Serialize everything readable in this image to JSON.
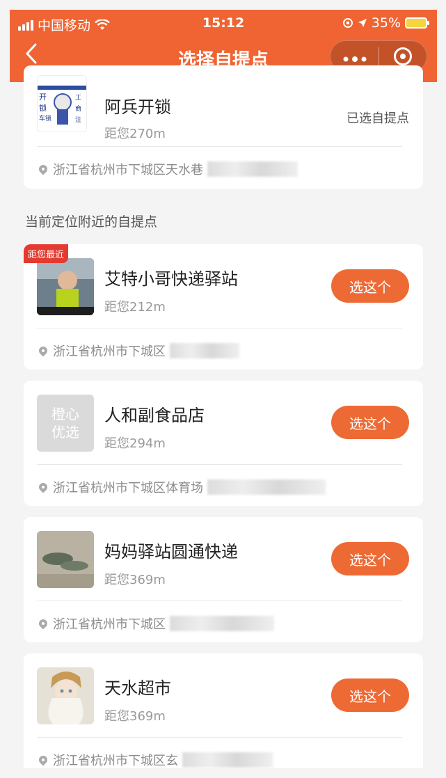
{
  "status_bar": {
    "carrier": "中国移动",
    "time": "15:12",
    "battery": "35%"
  },
  "nav": {
    "back_icon": "back-chevron-icon",
    "title": "选择自提点",
    "more_icon": "more-dots-icon",
    "close_icon": "target-circle-icon"
  },
  "selected_point": {
    "name": "阿兵开锁",
    "distance": "距您270m",
    "status": "已选自提点",
    "address": "浙江省杭州市下城区天水巷"
  },
  "section": {
    "title": "当前定位附近的自提点"
  },
  "points": [
    {
      "name": "艾特小哥快递驿站",
      "distance": "距您212m",
      "address": "浙江省杭州市下城区",
      "button": "选这个",
      "badge": "距您最近"
    },
    {
      "name": "人和副食品店",
      "distance": "距您294m",
      "address": "浙江省杭州市下城区体育场",
      "button": "选这个",
      "logo_text": "橙心优选"
    },
    {
      "name": "妈妈驿站圆通快递",
      "distance": "距您369m",
      "address": "浙江省杭州市下城区",
      "button": "选这个"
    },
    {
      "name": "天水超市",
      "distance": "距您369m",
      "address": "浙江省杭州市下城区玄",
      "button": "选这个"
    }
  ],
  "colors": {
    "accent": "#ef6432",
    "button": "#ee6a34",
    "badge": "#e43a2f"
  }
}
